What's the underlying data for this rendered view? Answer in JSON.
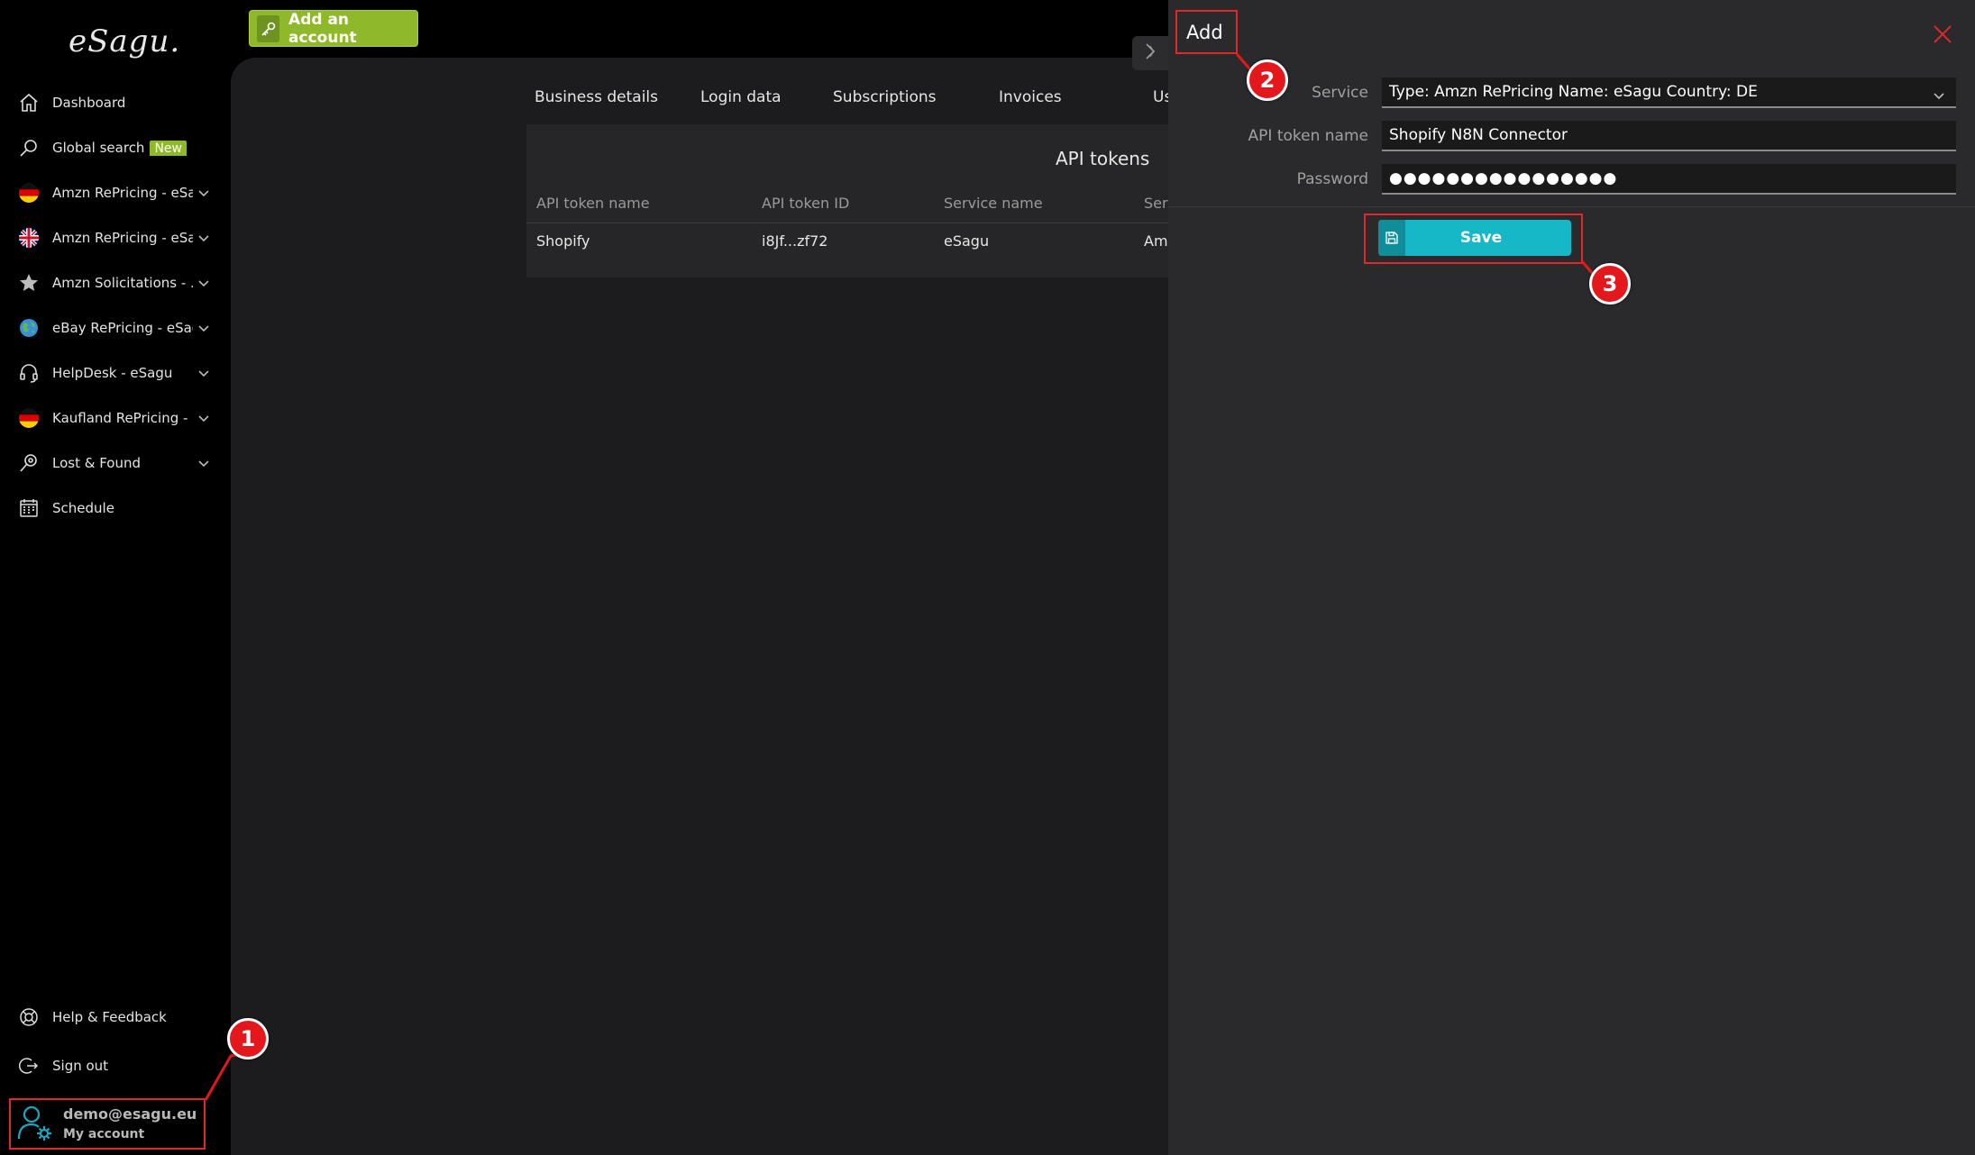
{
  "brand": {
    "logo": "eSagu."
  },
  "topbar": {
    "add_account_label": "Add an account"
  },
  "sidebar": {
    "items": [
      {
        "label": "Dashboard",
        "icon": "home-icon"
      },
      {
        "label": "Global search",
        "icon": "search-icon",
        "badge": "New"
      },
      {
        "label": "Amzn RePricing - eSa...",
        "icon": "flag-de-icon"
      },
      {
        "label": "Amzn RePricing - eSa...",
        "icon": "flag-uk-icon"
      },
      {
        "label": "Amzn Solicitations - ...",
        "icon": "star-icon"
      },
      {
        "label": "eBay RePricing - eSagu",
        "icon": "globe-icon"
      },
      {
        "label": "HelpDesk - eSagu",
        "icon": "headset-icon"
      },
      {
        "label": "Kaufland RePricing - ...",
        "icon": "flag-de-icon"
      },
      {
        "label": "Lost & Found",
        "icon": "lost-found-icon"
      },
      {
        "label": "Schedule",
        "icon": "calendar-icon"
      }
    ],
    "footer": [
      {
        "label": "Help & Feedback",
        "icon": "lifebuoy-icon"
      },
      {
        "label": "Sign out",
        "icon": "sign-out-icon"
      }
    ],
    "account": {
      "email": "demo@esagu.eu",
      "label": "My account"
    }
  },
  "main": {
    "tabs": [
      "Business details",
      "Login data",
      "Subscriptions",
      "Invoices",
      "Us"
    ],
    "panel_title": "API tokens",
    "table": {
      "headers": [
        "API token name",
        "API token ID",
        "Service name",
        "Ser"
      ],
      "rows": [
        [
          "Shopify",
          "i8Jf...zf72",
          "eSagu",
          "Am"
        ]
      ]
    }
  },
  "drawer": {
    "title": "Add",
    "service_label": "Service",
    "service_value": "Type: Amzn RePricing Name: eSagu Country: DE",
    "token_name_label": "API token name",
    "token_name_value": "Shopify N8N Connector",
    "password_label": "Password",
    "password_value": "●●●●●●●●●●●●●●●●",
    "save_label": "Save"
  },
  "markers": [
    "1",
    "2",
    "3"
  ],
  "colors": {
    "accent_green": "#8fb82a",
    "save_teal": "#16b8c7",
    "highlight_red": "#e0282a"
  }
}
